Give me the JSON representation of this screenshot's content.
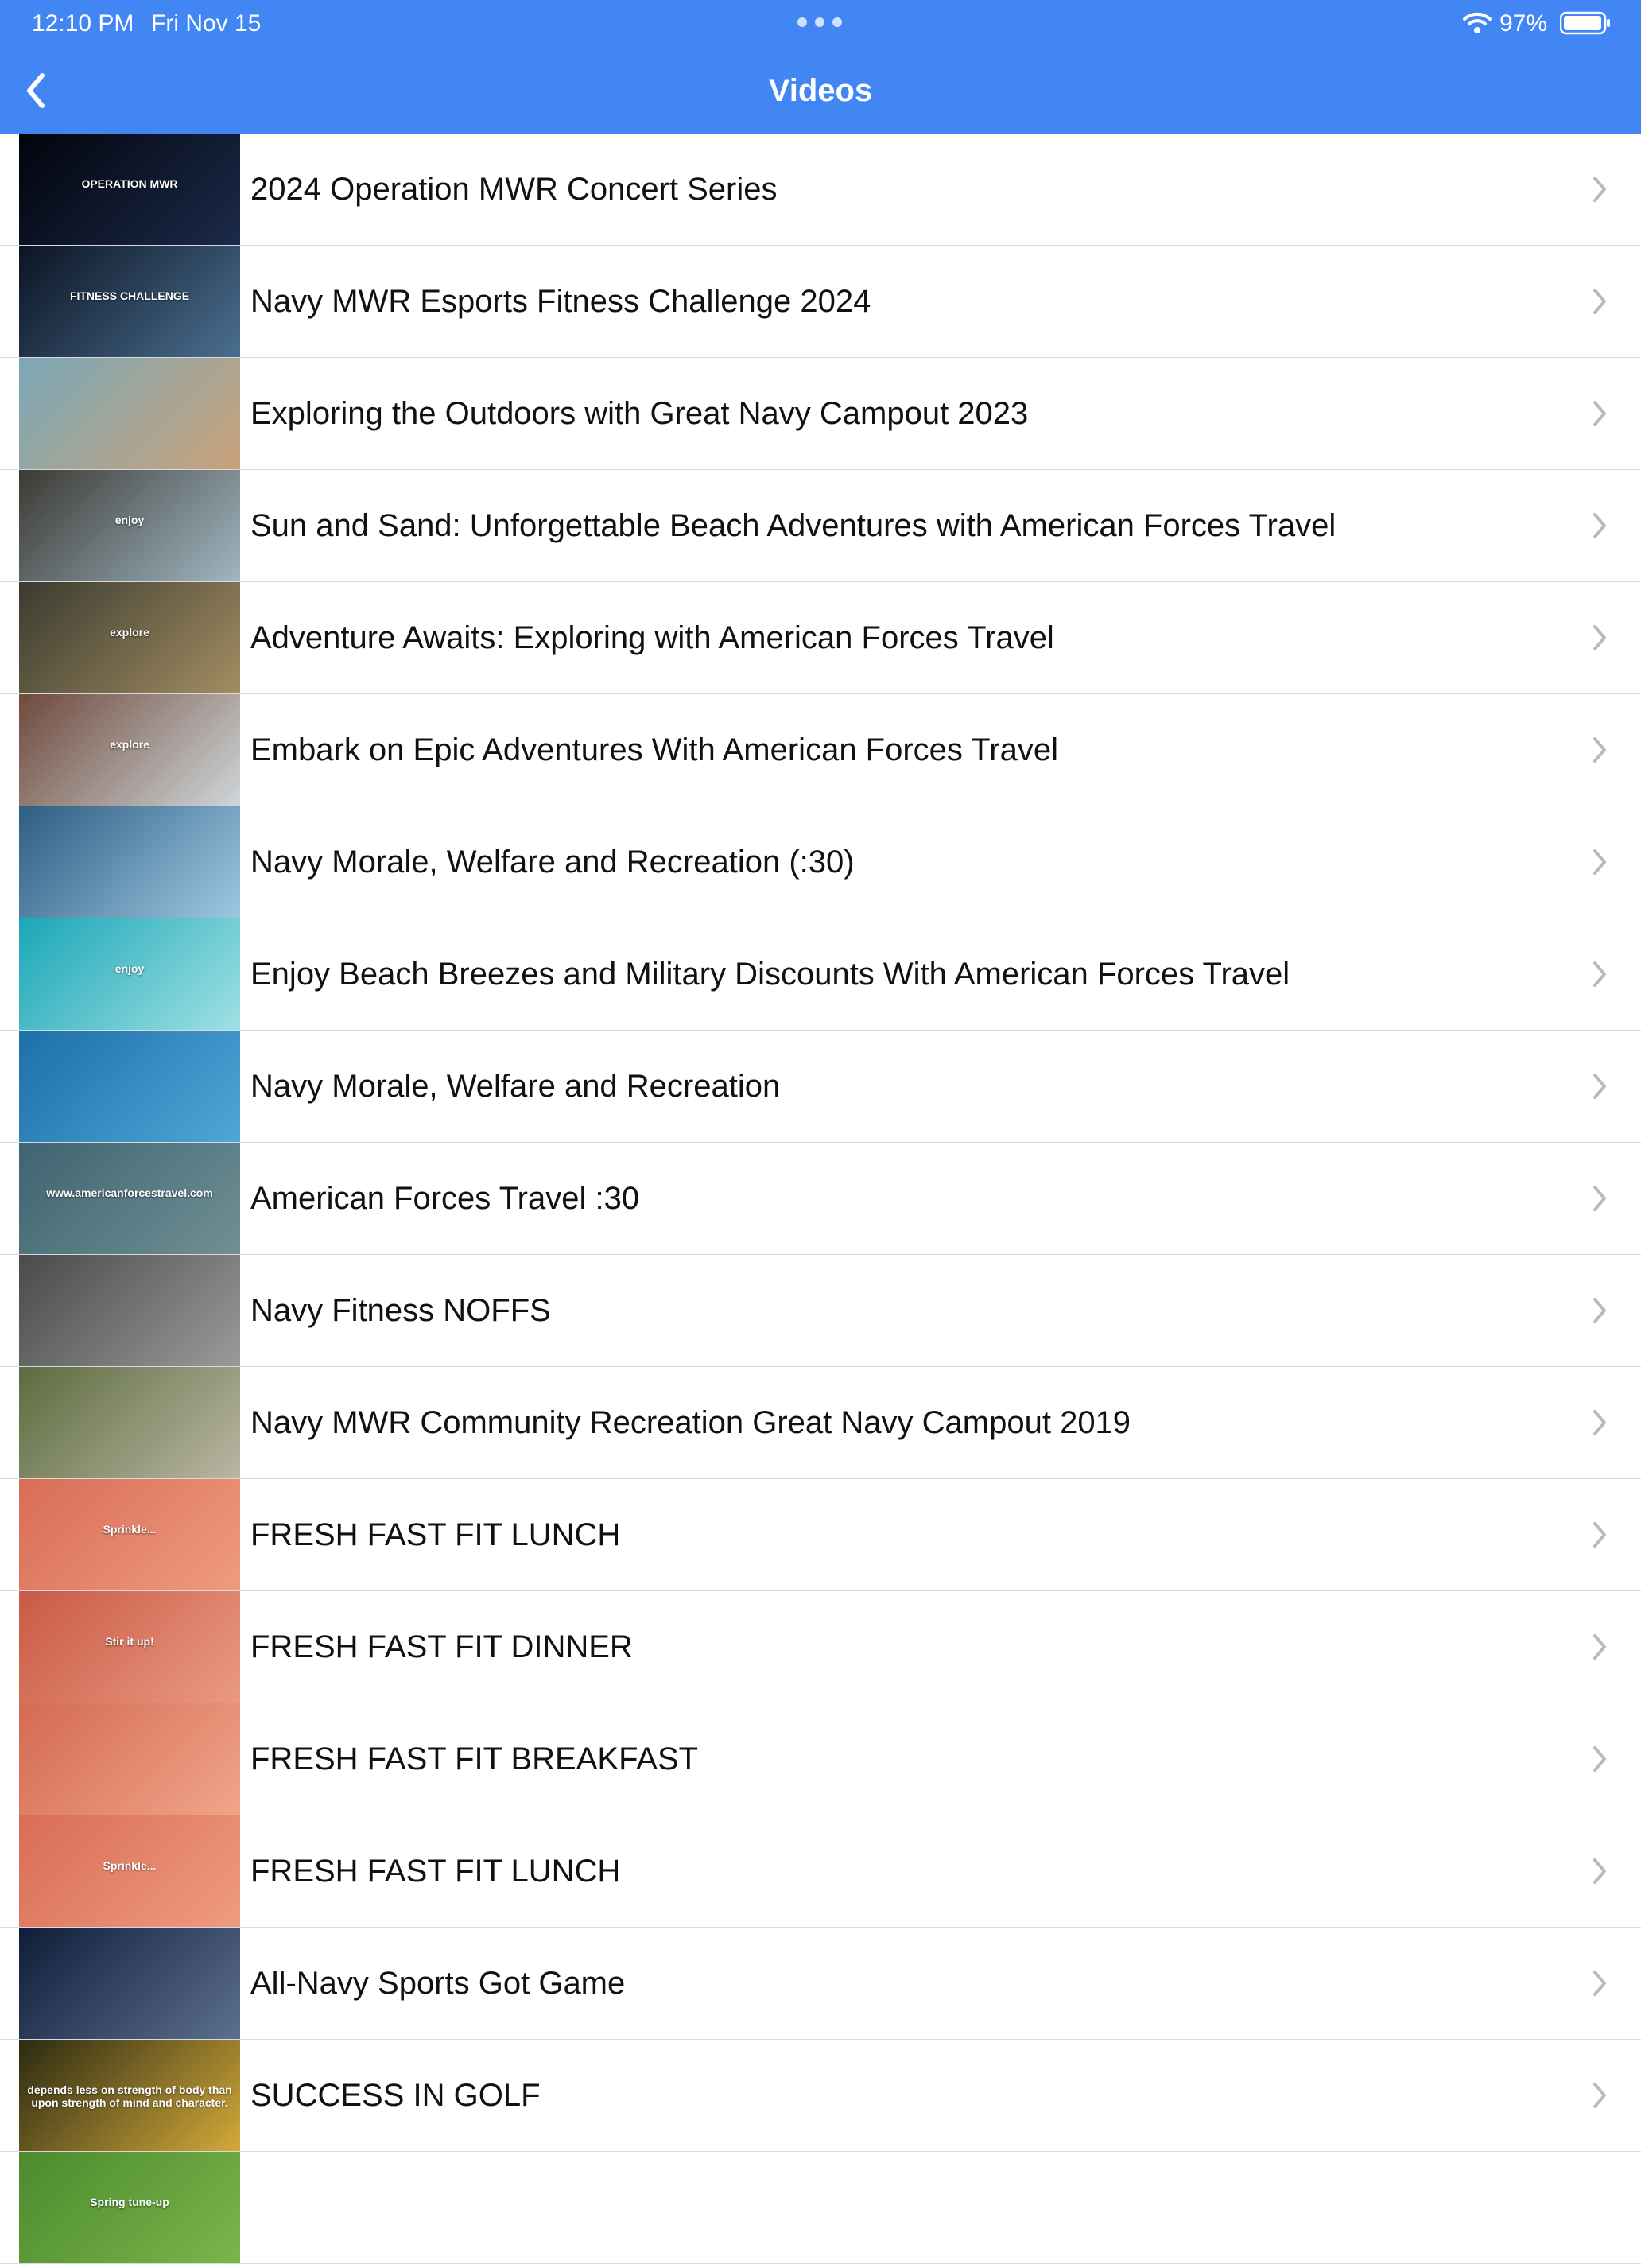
{
  "status_bar": {
    "time": "12:10 PM",
    "date": "Fri Nov 15",
    "battery": "97%"
  },
  "nav": {
    "title": "Videos"
  },
  "videos": [
    {
      "title": "2024 Operation MWR Concert Series",
      "thumb_text": "OPERATION MWR",
      "thumb_colors": [
        "#02040c",
        "#1b2a4a"
      ]
    },
    {
      "title": "Navy MWR Esports Fitness Challenge 2024",
      "thumb_text": "FITNESS CHALLENGE",
      "thumb_colors": [
        "#0b1424",
        "#4a6e8f"
      ]
    },
    {
      "title": "Exploring the Outdoors with Great Navy Campout 2023",
      "thumb_text": "",
      "thumb_colors": [
        "#7aa8b8",
        "#c9a27a"
      ]
    },
    {
      "title": "Sun and Sand: Unforgettable Beach Adventures with American Forces Travel",
      "thumb_text": "enjoy",
      "thumb_colors": [
        "#3c3a34",
        "#9fb6c2"
      ]
    },
    {
      "title": "Adventure Awaits: Exploring with American Forces Travel",
      "thumb_text": "explore",
      "thumb_colors": [
        "#3a3b2f",
        "#a28d63"
      ]
    },
    {
      "title": "Embark on Epic Adventures With American Forces Travel",
      "thumb_text": "explore",
      "thumb_colors": [
        "#6f4a3c",
        "#cfd6d9"
      ]
    },
    {
      "title": "Navy Morale, Welfare and Recreation (:30)",
      "thumb_text": "",
      "thumb_colors": [
        "#2f5e85",
        "#9cc7df"
      ]
    },
    {
      "title": "Enjoy Beach Breezes and Military Discounts With American Forces Travel",
      "thumb_text": "enjoy",
      "thumb_colors": [
        "#1ba7b7",
        "#9fe0e4"
      ]
    },
    {
      "title": "Navy Morale, Welfare and Recreation",
      "thumb_text": "",
      "thumb_colors": [
        "#1d6fa8",
        "#4fa6d8"
      ]
    },
    {
      "title": "American Forces Travel :30",
      "thumb_text": "www.americanforcestravel.com",
      "thumb_colors": [
        "#3f6470",
        "#6f8f94"
      ]
    },
    {
      "title": "Navy Fitness NOFFS",
      "thumb_text": "",
      "thumb_colors": [
        "#4a4a4a",
        "#9a9a9a"
      ]
    },
    {
      "title": "Navy MWR Community Recreation Great Navy Campout 2019",
      "thumb_text": "",
      "thumb_colors": [
        "#5d6b3f",
        "#b9b7a3"
      ]
    },
    {
      "title": "FRESH FAST FIT LUNCH",
      "thumb_text": "Sprinkle...",
      "thumb_colors": [
        "#d86d55",
        "#ef9b80"
      ]
    },
    {
      "title": "FRESH FAST FIT DINNER",
      "thumb_text": "Stir it up!",
      "thumb_colors": [
        "#c95a45",
        "#ea9a82"
      ]
    },
    {
      "title": "FRESH FAST FIT BREAKFAST",
      "thumb_text": "",
      "thumb_colors": [
        "#d46a52",
        "#f0a58a"
      ]
    },
    {
      "title": "FRESH FAST FIT LUNCH",
      "thumb_text": "Sprinkle...",
      "thumb_colors": [
        "#d86d55",
        "#ef9b80"
      ]
    },
    {
      "title": "All-Navy Sports Got Game",
      "thumb_text": "",
      "thumb_colors": [
        "#0f1d3a",
        "#5c6f8e"
      ]
    },
    {
      "title": "SUCCESS IN GOLF",
      "thumb_text": "depends less on strength of body than upon strength of mind and character.",
      "thumb_colors": [
        "#2b2a12",
        "#d3a93a"
      ]
    },
    {
      "title": "",
      "thumb_text": "Spring tune-up",
      "thumb_colors": [
        "#4d8a2e",
        "#79b64a"
      ]
    }
  ]
}
